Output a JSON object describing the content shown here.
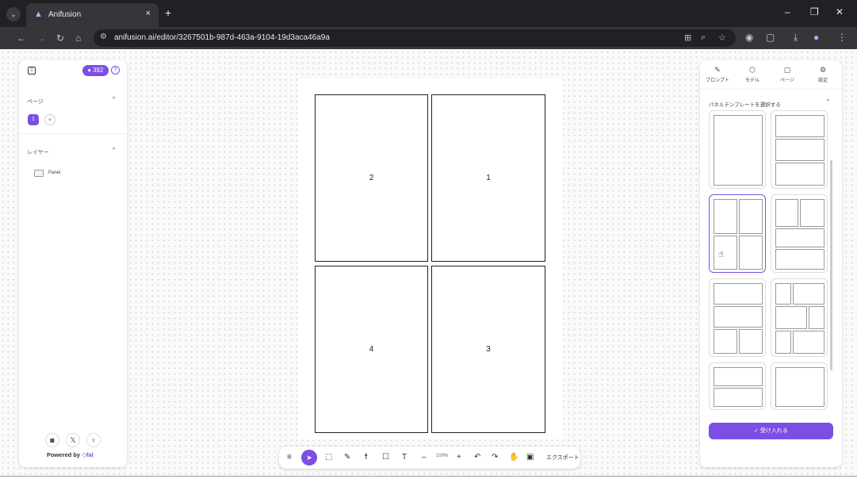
{
  "browser": {
    "tab_title": "Anifusion",
    "tab_close": "×",
    "new_tab": "+",
    "url": "anifusion.ai/editor/3267501b-987d-463a-9104-19d3aca46a9a",
    "window_minimize": "–",
    "window_restore": "❐",
    "window_close": "✕"
  },
  "left_panel": {
    "credits": "392",
    "pages_label": "ページ",
    "current_page": "1",
    "add_page": "+",
    "layers_label": "レイヤー",
    "layer_item": "Panel",
    "powered_by": "Powered by",
    "powered_brand": "fal"
  },
  "canvas": {
    "panels": [
      {
        "label": "2"
      },
      {
        "label": "1"
      },
      {
        "label": "4"
      },
      {
        "label": "3"
      }
    ]
  },
  "toolbar": {
    "zoom": "100%",
    "export_label": "エクスポート"
  },
  "right_panel": {
    "tabs": [
      {
        "label": "プロンプト",
        "icon": "pen-icon"
      },
      {
        "label": "モデル",
        "icon": "cube-icon"
      },
      {
        "label": "ページ",
        "icon": "page-icon"
      },
      {
        "label": "設定",
        "icon": "gear-icon"
      }
    ],
    "section_title": "パネルテンプレートを選択する",
    "accept_label": "✓ 受け入れる"
  },
  "colors": {
    "accent": "#7c4ee4"
  }
}
